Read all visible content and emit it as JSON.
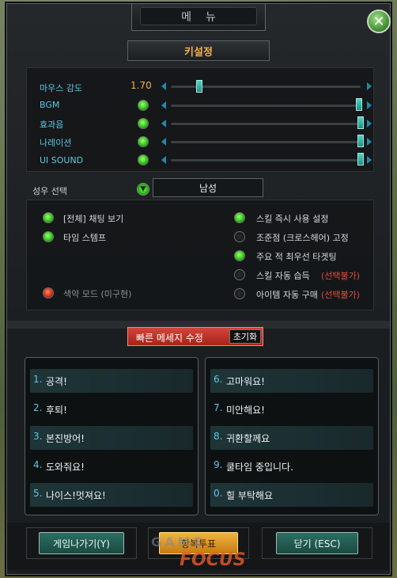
{
  "window": {
    "title": "메뉴"
  },
  "section": {
    "title": "키설정"
  },
  "sliders": {
    "mouse": {
      "label": "마우스 감도",
      "value": "1.70",
      "level": 0.19
    },
    "bgm": {
      "label": "BGM",
      "level": 1.0
    },
    "sfx": {
      "label": "효과음",
      "level": 1.0
    },
    "narration": {
      "label": "나레이션",
      "level": 1.0
    },
    "ui": {
      "label": "UI SOUND",
      "level": 1.0
    }
  },
  "voice": {
    "label": "성우 선택",
    "selected": "남성"
  },
  "options": {
    "left": [
      {
        "label": "[전체] 채팅 보기",
        "state": "on"
      },
      {
        "label": "타임 스템프",
        "state": "on"
      },
      {
        "label": "색약 모드 (미구현)",
        "state": "red"
      }
    ],
    "right": [
      {
        "label": "스킬 즉시 사용 설정",
        "state": "on",
        "note": ""
      },
      {
        "label": "조준점 (크로스헤어) 고정",
        "state": "off",
        "note": ""
      },
      {
        "label": "주요 적 최우선 타겟팅",
        "state": "on",
        "note": ""
      },
      {
        "label": "스킬 자동 습득",
        "state": "off",
        "note": "(선택불가)"
      },
      {
        "label": "아이템 자동 구매",
        "state": "off",
        "note": "(선택불가)"
      }
    ]
  },
  "quick_messages": {
    "title": "빠른 메세지 수정",
    "reset_label": "초기화",
    "left": [
      {
        "num": "1.",
        "text": "공격!"
      },
      {
        "num": "2.",
        "text": "후퇴!"
      },
      {
        "num": "3.",
        "text": "본진방어!"
      },
      {
        "num": "4.",
        "text": "도와줘요!"
      },
      {
        "num": "5.",
        "text": "나이스!멋져요!"
      }
    ],
    "right": [
      {
        "num": "6.",
        "text": "고마워요!"
      },
      {
        "num": "7.",
        "text": "미안해요!"
      },
      {
        "num": "8.",
        "text": "귀환할께요"
      },
      {
        "num": "9.",
        "text": "쿨타임 중입니다."
      },
      {
        "num": "0.",
        "text": "힐 부탁해요"
      }
    ]
  },
  "buttons": {
    "exit": "게임나가기(Y)",
    "vote": "항복투표",
    "close": "닫기 (ESC)"
  },
  "watermark": {
    "top": "GAME",
    "bottom": "FOCUS"
  },
  "colors": {
    "accent_orange": "#f2b04a",
    "label_cyan": "#5bc7e3",
    "toggle_green": "#34c61b",
    "warning_red": "#e24a3a"
  }
}
